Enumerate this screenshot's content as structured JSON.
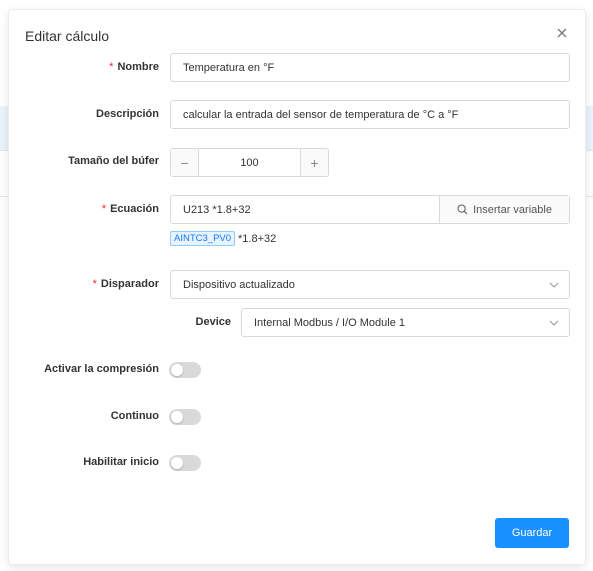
{
  "dialog": {
    "title": "Editar cálculo",
    "required_mark": "*"
  },
  "form": {
    "name": {
      "label": "Nombre",
      "value": "Temperatura en °F"
    },
    "description": {
      "label": "Descripción",
      "value": "calcular la entrada del sensor de temperatura de °C a °F"
    },
    "buffer": {
      "label": "Tamaño del búfer",
      "value": "100",
      "decrement": "−",
      "increment": "+"
    },
    "equation": {
      "label": "Ecuación",
      "value": "U213 *1.8+32",
      "insert_button": "Insertar variable",
      "preview_tag": "AINTC3_PV0",
      "preview_rest": "*1.8+32"
    },
    "trigger": {
      "label": "Disparador",
      "value": "Dispositivo actualizado"
    },
    "device": {
      "label": "Device",
      "value": "Internal Modbus / I/O Module 1"
    },
    "compression": {
      "label": "Activar la compresión",
      "on": false
    },
    "continuous": {
      "label": "Continuo",
      "on": false
    },
    "enable_start": {
      "label": "Habilitar inicio",
      "on": false
    }
  },
  "footer": {
    "save_label": "Guardar"
  },
  "colors": {
    "primary": "#1890ff",
    "required": "#f5222d",
    "tag_bg": "#e6f4ff",
    "tag_text": "#1677ff"
  },
  "icons": {
    "close": "close-icon",
    "search": "search-icon",
    "chevron": "chevron-down-icon"
  }
}
